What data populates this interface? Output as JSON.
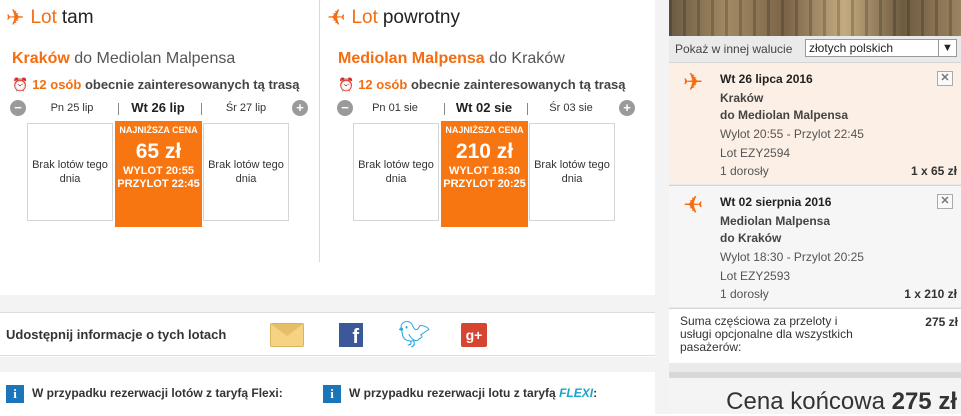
{
  "outbound": {
    "title_prefix": "Lot",
    "title_main": "tam",
    "route_from": "Kraków",
    "route_connector": "do",
    "route_to": "Mediolan Malpensa",
    "interest_count": "12 osób",
    "interest_text": "obecnie zainteresowanych tą trasą",
    "dates": [
      "Pn 25 lip",
      "Wt 26 lip",
      "Śr 27 lip"
    ],
    "no_flights": "Brak lotów tego dnia",
    "selected": {
      "label": "NAJNIŻSZA CENA",
      "price": "65 zł",
      "departure": "WYLOT 20:55",
      "arrival": "PRZYLOT 22:45"
    }
  },
  "return": {
    "title_prefix": "Lot",
    "title_main": "powrotny",
    "route_from": "Mediolan Malpensa",
    "route_connector": "do",
    "route_to": "Kraków",
    "interest_count": "12 osób",
    "interest_text": "obecnie zainteresowanych tą trasą",
    "dates": [
      "Pn 01 sie",
      "Wt 02 sie",
      "Śr 03 sie"
    ],
    "no_flights": "Brak lotów tego dnia",
    "selected": {
      "label": "NAJNIŻSZA CENA",
      "price": "210 zł",
      "departure": "WYLOT 18:30",
      "arrival": "PRZYLOT 20:25"
    }
  },
  "share": {
    "label": "Udostępnij informacje o tych lotach"
  },
  "info": {
    "left": "W przypadku rezerwacji lotów z taryfą Flexi:",
    "right_prefix": "W przypadku rezerwacji lotu z taryfą",
    "right_flexi": "FLEXI",
    "right_suffix": ":"
  },
  "sidebar": {
    "currency_label": "Pokaż w innej walucie",
    "currency_value": "złotych polskich",
    "segments": [
      {
        "date": "Wt 26 lipca 2016",
        "from": "Kraków",
        "to": "do Mediolan Malpensa",
        "times": "Wylot 20:55 - Przylot 22:45",
        "flight": "Lot EZY2594",
        "pax": "1 dorosły",
        "price": "1 x 65 zł"
      },
      {
        "date": "Wt 02 sierpnia 2016",
        "from": "Mediolan Malpensa",
        "to": "do Kraków",
        "times": "Wylot 18:30 - Przylot 20:25",
        "flight": "Lot EZY2593",
        "pax": "1 dorosły",
        "price": "1 x 210 zł"
      }
    ],
    "subtotal_label": "Suma częściowa za przeloty i usługi opcjonalne dla wszystkich pasażerów:",
    "subtotal_value": "275 zł",
    "final_label": "Cena końcowa",
    "final_value": "275 zł"
  },
  "colors": {
    "accent": "#f56d10",
    "selected_day": "#f77611",
    "info_icon": "#1a76b8"
  }
}
